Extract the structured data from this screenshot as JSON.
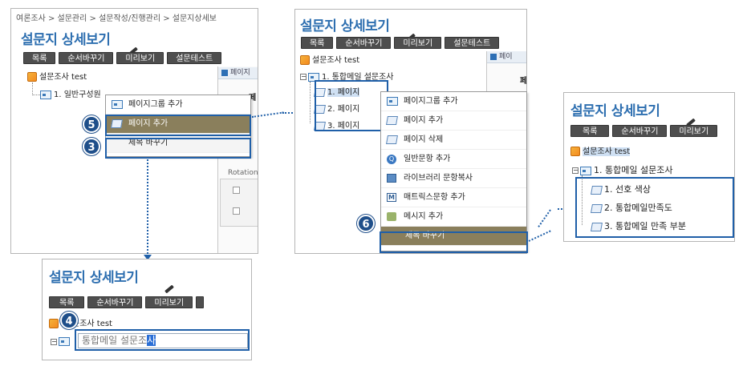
{
  "panel1": {
    "breadcrumb": "여론조사 > 설문관리 > 설문작성/진행관리 > 설문지상세보",
    "title": "설문지 상세보기",
    "buttons": [
      "목록",
      "순서바꾸기",
      "미리보기",
      "설문테스트"
    ],
    "tree_root": "설문조사 test",
    "tree_child": "1. 일반구성원",
    "grid_tab": "페이지",
    "grid_col": "페",
    "grid_rotation": "Rotation",
    "menu": [
      "페이지그룹 추가",
      "페이지 추가"
    ],
    "rename_item": "제목 바꾸기"
  },
  "panel2": {
    "title": "설문지 상세보기",
    "buttons": [
      "목록",
      "순서바꾸기",
      "미리보기",
      "설문테스트"
    ],
    "tree_root": "설문조사 test",
    "tree_group": "1. 통합메일 설문조사",
    "pages": [
      "1. 페이지",
      "2. 페이지",
      "3. 페이지"
    ],
    "grid_tab": "페이",
    "grid_col": "페",
    "menu": [
      "페이지그룹 추가",
      "페이지 추가",
      "페이지 삭제",
      "일반문항 추가",
      "라이브러리 문항복사",
      "매트릭스문항 추가",
      "메시지 추가"
    ],
    "rename_item": "제목 바꾸기"
  },
  "panel3": {
    "title": "설문지 상세보기",
    "buttons": [
      "목록",
      "순서바꾸기",
      "미리보기"
    ],
    "tree_root": "설문조사 test",
    "tree_group": "1. 통합메일 설문조사",
    "pages": [
      "1. 선호 색상",
      "2. 통합메일만족도",
      "3. 통합메일 만족 부분"
    ]
  },
  "panel4": {
    "title": "설문지 상세보기",
    "buttons": [
      "목록",
      "순서바꾸기",
      "미리보기"
    ],
    "tree_root": "문조사 test",
    "edit_value": "통합메일 설문조",
    "edit_selected": "사"
  },
  "badges": {
    "b5": "5",
    "b3": "3",
    "b6": "6",
    "b4": "4"
  },
  "colors": {
    "accent": "#1f5fa8",
    "title": "#2e6fb0",
    "highlight": "#8a7f5c"
  }
}
